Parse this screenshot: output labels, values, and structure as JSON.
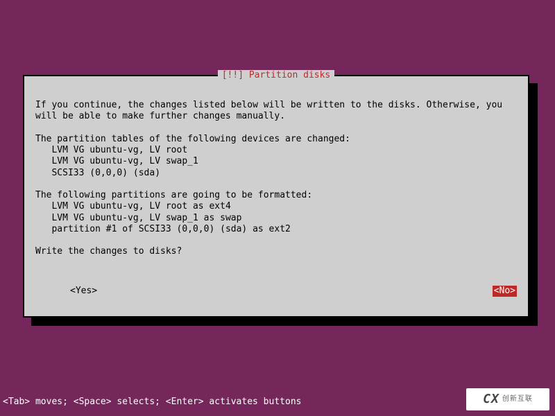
{
  "dialog": {
    "title": "[!!] Partition disks",
    "intro": "If you continue, the changes listed below will be written to the disks. Otherwise, you\nwill be able to make further changes manually.",
    "tables_header": "The partition tables of the following devices are changed:",
    "tables_items": [
      "LVM VG ubuntu-vg, LV root",
      "LVM VG ubuntu-vg, LV swap_1",
      "SCSI33 (0,0,0) (sda)"
    ],
    "format_header": "The following partitions are going to be formatted:",
    "format_items": [
      "LVM VG ubuntu-vg, LV root as ext4",
      "LVM VG ubuntu-vg, LV swap_1 as swap",
      "partition #1 of SCSI33 (0,0,0) (sda) as ext2"
    ],
    "question": "Write the changes to disks?",
    "yes_label": "<Yes>",
    "no_label": "<No>"
  },
  "footer": "<Tab> moves; <Space> selects; <Enter> activates buttons",
  "watermark": {
    "logo": "CX",
    "text": "创新互联"
  }
}
